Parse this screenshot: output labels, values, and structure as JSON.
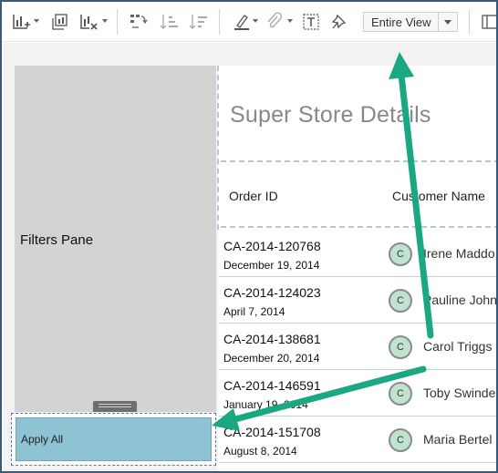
{
  "toolbar": {
    "icons": [
      "add-chart-icon",
      "duplicate-sheet-icon",
      "clear-sheet-icon",
      "swap-icon",
      "sort-ascending-icon",
      "sort-descending-icon",
      "highlight-icon",
      "group-icon",
      "show-labels-icon",
      "pin-icon"
    ],
    "view_select": {
      "value": "Entire View"
    }
  },
  "filters_pane": {
    "label": "Filters Pane",
    "apply_label": "Apply All"
  },
  "dashboard": {
    "title": "Super Store Details",
    "columns": [
      "Order ID",
      "Customer Name"
    ],
    "rows": [
      {
        "order_id": "CA-2014-120768",
        "date": "December 19, 2014",
        "initial": "C",
        "customer": "Irene Maddo"
      },
      {
        "order_id": "CA-2014-124023",
        "date": "April 7, 2014",
        "initial": "C",
        "customer": "Pauline John"
      },
      {
        "order_id": "CA-2014-138681",
        "date": "December 20, 2014",
        "initial": "C",
        "customer": "Carol Triggs"
      },
      {
        "order_id": "CA-2014-146591",
        "date": "January 19, 2014",
        "initial": "C",
        "customer": "Toby Swindel"
      },
      {
        "order_id": "CA-2014-151708",
        "date": "August 8, 2014",
        "initial": "C",
        "customer": "Maria Bertel"
      }
    ]
  },
  "colors": {
    "accent_arrow": "#1aa882",
    "apply_button": "#8ec3d3",
    "badge": "#bfe3cf",
    "filters_pane": "#d3d3d3"
  }
}
